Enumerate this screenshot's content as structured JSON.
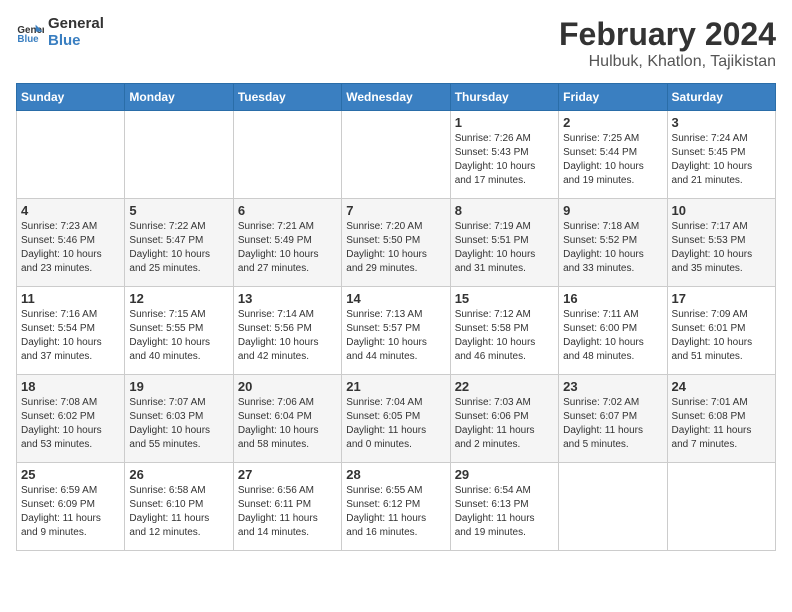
{
  "header": {
    "logo_line1": "General",
    "logo_line2": "Blue",
    "title": "February 2024",
    "subtitle": "Hulbuk, Khatlon, Tajikistan"
  },
  "calendar": {
    "days_of_week": [
      "Sunday",
      "Monday",
      "Tuesday",
      "Wednesday",
      "Thursday",
      "Friday",
      "Saturday"
    ],
    "weeks": [
      [
        {
          "day": "",
          "info": ""
        },
        {
          "day": "",
          "info": ""
        },
        {
          "day": "",
          "info": ""
        },
        {
          "day": "",
          "info": ""
        },
        {
          "day": "1",
          "info": "Sunrise: 7:26 AM\nSunset: 5:43 PM\nDaylight: 10 hours\nand 17 minutes."
        },
        {
          "day": "2",
          "info": "Sunrise: 7:25 AM\nSunset: 5:44 PM\nDaylight: 10 hours\nand 19 minutes."
        },
        {
          "day": "3",
          "info": "Sunrise: 7:24 AM\nSunset: 5:45 PM\nDaylight: 10 hours\nand 21 minutes."
        }
      ],
      [
        {
          "day": "4",
          "info": "Sunrise: 7:23 AM\nSunset: 5:46 PM\nDaylight: 10 hours\nand 23 minutes."
        },
        {
          "day": "5",
          "info": "Sunrise: 7:22 AM\nSunset: 5:47 PM\nDaylight: 10 hours\nand 25 minutes."
        },
        {
          "day": "6",
          "info": "Sunrise: 7:21 AM\nSunset: 5:49 PM\nDaylight: 10 hours\nand 27 minutes."
        },
        {
          "day": "7",
          "info": "Sunrise: 7:20 AM\nSunset: 5:50 PM\nDaylight: 10 hours\nand 29 minutes."
        },
        {
          "day": "8",
          "info": "Sunrise: 7:19 AM\nSunset: 5:51 PM\nDaylight: 10 hours\nand 31 minutes."
        },
        {
          "day": "9",
          "info": "Sunrise: 7:18 AM\nSunset: 5:52 PM\nDaylight: 10 hours\nand 33 minutes."
        },
        {
          "day": "10",
          "info": "Sunrise: 7:17 AM\nSunset: 5:53 PM\nDaylight: 10 hours\nand 35 minutes."
        }
      ],
      [
        {
          "day": "11",
          "info": "Sunrise: 7:16 AM\nSunset: 5:54 PM\nDaylight: 10 hours\nand 37 minutes."
        },
        {
          "day": "12",
          "info": "Sunrise: 7:15 AM\nSunset: 5:55 PM\nDaylight: 10 hours\nand 40 minutes."
        },
        {
          "day": "13",
          "info": "Sunrise: 7:14 AM\nSunset: 5:56 PM\nDaylight: 10 hours\nand 42 minutes."
        },
        {
          "day": "14",
          "info": "Sunrise: 7:13 AM\nSunset: 5:57 PM\nDaylight: 10 hours\nand 44 minutes."
        },
        {
          "day": "15",
          "info": "Sunrise: 7:12 AM\nSunset: 5:58 PM\nDaylight: 10 hours\nand 46 minutes."
        },
        {
          "day": "16",
          "info": "Sunrise: 7:11 AM\nSunset: 6:00 PM\nDaylight: 10 hours\nand 48 minutes."
        },
        {
          "day": "17",
          "info": "Sunrise: 7:09 AM\nSunset: 6:01 PM\nDaylight: 10 hours\nand 51 minutes."
        }
      ],
      [
        {
          "day": "18",
          "info": "Sunrise: 7:08 AM\nSunset: 6:02 PM\nDaylight: 10 hours\nand 53 minutes."
        },
        {
          "day": "19",
          "info": "Sunrise: 7:07 AM\nSunset: 6:03 PM\nDaylight: 10 hours\nand 55 minutes."
        },
        {
          "day": "20",
          "info": "Sunrise: 7:06 AM\nSunset: 6:04 PM\nDaylight: 10 hours\nand 58 minutes."
        },
        {
          "day": "21",
          "info": "Sunrise: 7:04 AM\nSunset: 6:05 PM\nDaylight: 11 hours\nand 0 minutes."
        },
        {
          "day": "22",
          "info": "Sunrise: 7:03 AM\nSunset: 6:06 PM\nDaylight: 11 hours\nand 2 minutes."
        },
        {
          "day": "23",
          "info": "Sunrise: 7:02 AM\nSunset: 6:07 PM\nDaylight: 11 hours\nand 5 minutes."
        },
        {
          "day": "24",
          "info": "Sunrise: 7:01 AM\nSunset: 6:08 PM\nDaylight: 11 hours\nand 7 minutes."
        }
      ],
      [
        {
          "day": "25",
          "info": "Sunrise: 6:59 AM\nSunset: 6:09 PM\nDaylight: 11 hours\nand 9 minutes."
        },
        {
          "day": "26",
          "info": "Sunrise: 6:58 AM\nSunset: 6:10 PM\nDaylight: 11 hours\nand 12 minutes."
        },
        {
          "day": "27",
          "info": "Sunrise: 6:56 AM\nSunset: 6:11 PM\nDaylight: 11 hours\nand 14 minutes."
        },
        {
          "day": "28",
          "info": "Sunrise: 6:55 AM\nSunset: 6:12 PM\nDaylight: 11 hours\nand 16 minutes."
        },
        {
          "day": "29",
          "info": "Sunrise: 6:54 AM\nSunset: 6:13 PM\nDaylight: 11 hours\nand 19 minutes."
        },
        {
          "day": "",
          "info": ""
        },
        {
          "day": "",
          "info": ""
        }
      ]
    ]
  }
}
